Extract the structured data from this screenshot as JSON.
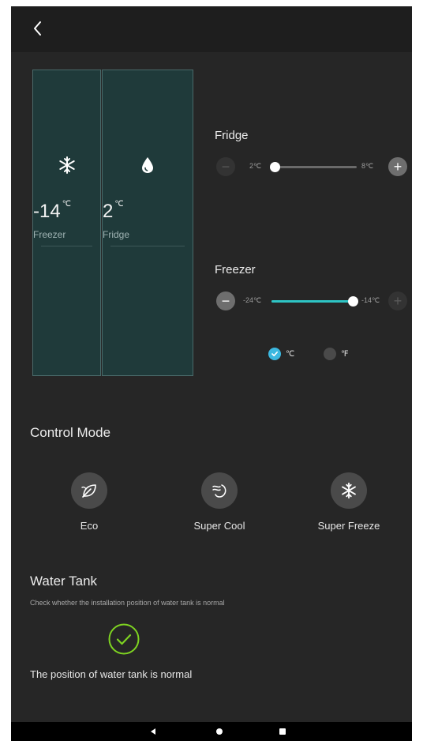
{
  "colors": {
    "background": "#262626",
    "topbar": "#1e1e1e",
    "panel_fill": "#1f3a3a",
    "panel_border": "#4a6a6a",
    "slider_fill": "#2ec4c4",
    "radio_selected": "#3cb8e0",
    "check_green": "#7ed321"
  },
  "header": {
    "back_icon": "chevron-left-icon"
  },
  "compartments": [
    {
      "name": "Freezer",
      "temp": "-14",
      "unit": "℃",
      "icon": "snowflake-icon"
    },
    {
      "name": "Fridge",
      "temp": "2",
      "unit": "℃",
      "icon": "water-drop-icon"
    }
  ],
  "fridge_control": {
    "title": "Fridge",
    "min_label": "2℃",
    "max_label": "8℃",
    "min": 2,
    "max": 8,
    "value": 2
  },
  "freezer_control": {
    "title": "Freezer",
    "min_label": "-24℃",
    "max_label": "-14℃",
    "min": -24,
    "max": -14,
    "value": -14
  },
  "units": [
    {
      "label": "℃",
      "selected": true
    },
    {
      "label": "℉",
      "selected": false
    }
  ],
  "control_mode": {
    "title": "Control Mode",
    "modes": [
      {
        "label": "Eco",
        "icon": "leaf-icon"
      },
      {
        "label": "Super Cool",
        "icon": "super-cool-icon"
      },
      {
        "label": "Super Freeze",
        "icon": "snowflake-icon"
      }
    ]
  },
  "water_tank": {
    "title": "Water Tank",
    "subtitle": "Check whether the installation position of water tank is normal",
    "status": "The position of water tank is normal",
    "status_icon": "check-circle-icon"
  },
  "nav": {
    "back": "nav-back-icon",
    "home": "nav-home-icon",
    "recents": "nav-recents-icon"
  }
}
